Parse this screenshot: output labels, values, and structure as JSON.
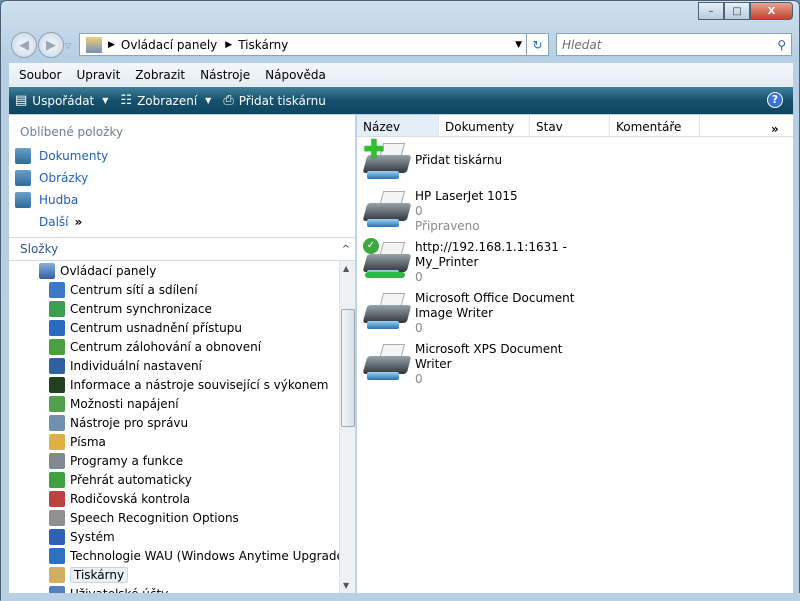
{
  "window": {
    "minimize": "–",
    "maximize": "□",
    "close": "X"
  },
  "address": {
    "path": [
      "Ovládací panely",
      "Tiskárny"
    ]
  },
  "search": {
    "placeholder": "Hledat"
  },
  "menu": [
    {
      "label": "Soubor"
    },
    {
      "label": "Upravit"
    },
    {
      "label": "Zobrazit"
    },
    {
      "label": "Nástroje"
    },
    {
      "label": "Nápověda"
    }
  ],
  "toolbar": {
    "organize": "Uspořádat",
    "views": "Zobrazení",
    "add_printer": "Přidat tiskárnu",
    "help": "?"
  },
  "favorites": {
    "title": "Oblíbené položky",
    "items": [
      {
        "label": "Dokumenty"
      },
      {
        "label": "Obrázky"
      },
      {
        "label": "Hudba"
      }
    ],
    "more": "Další"
  },
  "folders": {
    "title": "Složky",
    "root": "Ovládací panely",
    "items": [
      {
        "label": "Centrum sítí a sdílení",
        "color": "#3a7ac8"
      },
      {
        "label": "Centrum synchronizace",
        "color": "#3aa050"
      },
      {
        "label": "Centrum usnadnění přístupu",
        "color": "#2a6ac0"
      },
      {
        "label": "Centrum zálohování a obnovení",
        "color": "#4aa040"
      },
      {
        "label": "Individuální nastavení",
        "color": "#3060a0"
      },
      {
        "label": "Informace a nástroje související s výkonem",
        "color": "#204020"
      },
      {
        "label": "Možnosti napájení",
        "color": "#50a050"
      },
      {
        "label": "Nástroje pro správu",
        "color": "#7090b0"
      },
      {
        "label": "Písma",
        "color": "#e0b040"
      },
      {
        "label": "Programy a funkce",
        "color": "#808890"
      },
      {
        "label": "Přehrát automaticky",
        "color": "#40a040"
      },
      {
        "label": "Rodičovská kontrola",
        "color": "#c04040"
      },
      {
        "label": "Speech Recognition Options",
        "color": "#909090"
      },
      {
        "label": "Systém",
        "color": "#3060b0"
      },
      {
        "label": "Technologie WAU (Windows Anytime Upgrade)",
        "color": "#3070c0"
      },
      {
        "label": "Tiskárny",
        "color": "#d0b060",
        "selected": true
      },
      {
        "label": "Uživatelské účty",
        "color": "#5080c0"
      }
    ]
  },
  "columns": [
    "Název",
    "Dokumenty",
    "Stav",
    "Komentáře"
  ],
  "items": [
    {
      "name": "Přidat tiskárnu",
      "type": "add"
    },
    {
      "name": "HP LaserJet 1015",
      "lines": [
        "0",
        "Připraveno"
      ]
    },
    {
      "name": "http://192.168.1.1:1631 -",
      "name2": "My_Printer",
      "lines": [
        "0"
      ],
      "type": "network"
    },
    {
      "name": "Microsoft Office Document",
      "name2": "Image Writer",
      "lines": [
        "0"
      ]
    },
    {
      "name": "Microsoft XPS Document",
      "name2": "Writer",
      "lines": [
        "0"
      ]
    }
  ]
}
